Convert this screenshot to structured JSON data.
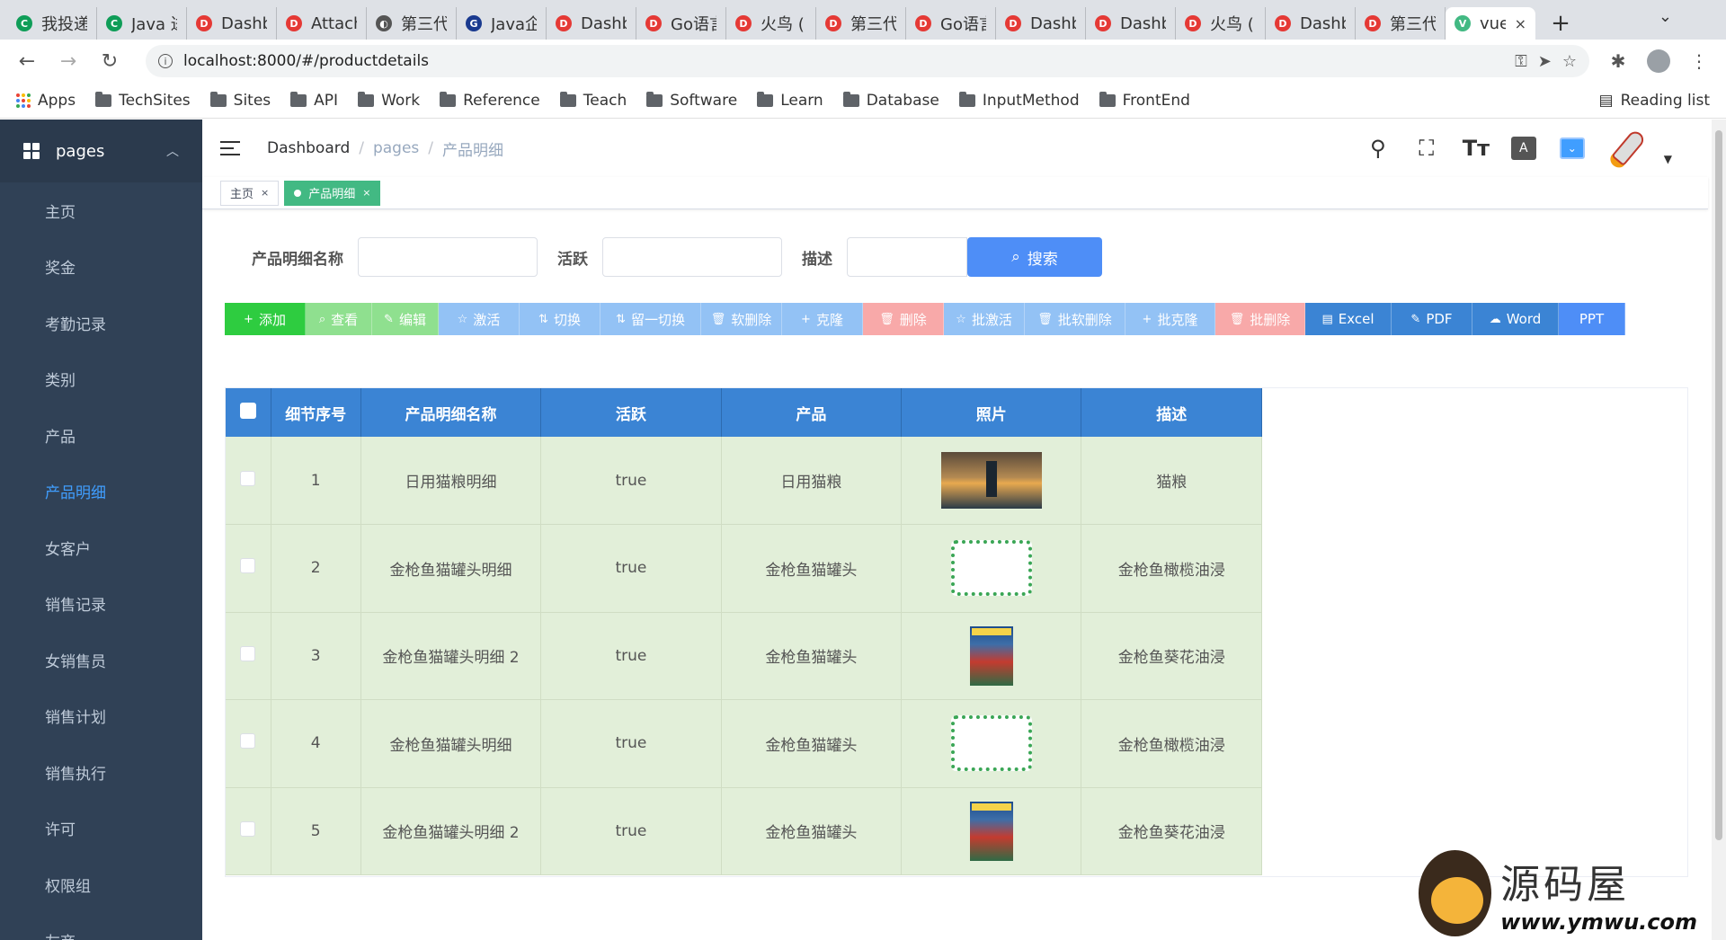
{
  "browser": {
    "tabs": [
      {
        "title": "我投递",
        "color": "#0f9d58",
        "glyph": "C"
      },
      {
        "title": "Java 进",
        "color": "#0f9d58",
        "glyph": "C"
      },
      {
        "title": "Dashb",
        "color": "#e53935",
        "glyph": "D"
      },
      {
        "title": "Attach",
        "color": "#e53935",
        "glyph": "D"
      },
      {
        "title": "第三代",
        "color": "#555555",
        "glyph": "◐"
      },
      {
        "title": "Java企",
        "color": "#1a3a8f",
        "glyph": "G"
      },
      {
        "title": "Dashb",
        "color": "#e53935",
        "glyph": "D"
      },
      {
        "title": "Go语言",
        "color": "#e53935",
        "glyph": "D"
      },
      {
        "title": "火鸟 (",
        "color": "#e53935",
        "glyph": "D"
      },
      {
        "title": "第三代",
        "color": "#e53935",
        "glyph": "D"
      },
      {
        "title": "Go语言",
        "color": "#e53935",
        "glyph": "D"
      },
      {
        "title": "Dashb",
        "color": "#e53935",
        "glyph": "D"
      },
      {
        "title": "Dashb",
        "color": "#e53935",
        "glyph": "D"
      },
      {
        "title": "火鸟 (",
        "color": "#e53935",
        "glyph": "D"
      },
      {
        "title": "Dashb",
        "color": "#e53935",
        "glyph": "D"
      },
      {
        "title": "第三代",
        "color": "#e53935",
        "glyph": "D"
      }
    ],
    "active_tab": {
      "title": "vue",
      "color": "#42b983",
      "glyph": "V",
      "close": "×"
    },
    "new_tab": "+",
    "tab_menu": "⌄",
    "url": "localhost:8000/#/productdetails",
    "bookmarks": [
      "Apps",
      "TechSites",
      "Sites",
      "API",
      "Work",
      "Reference",
      "Teach",
      "Software",
      "Learn",
      "Database",
      "InputMethod",
      "FrontEnd"
    ],
    "reading_list": "Reading list"
  },
  "sidebar": {
    "header": "pages",
    "items": [
      "主页",
      "奖金",
      "考勤记录",
      "类别",
      "产品",
      "产品明细",
      "女客户",
      "销售记录",
      "女销售员",
      "销售计划",
      "销售执行",
      "许可",
      "权限组",
      "友商"
    ],
    "active_index": 5
  },
  "navbar": {
    "breadcrumb": [
      "Dashboard",
      "pages",
      "产品明细"
    ]
  },
  "tags": {
    "items": [
      {
        "label": "主页",
        "close": "×"
      },
      {
        "label": "产品明细",
        "close": "×"
      }
    ]
  },
  "filters": {
    "name_label": "产品明细名称",
    "active_label": "活跃",
    "desc_label": "描述",
    "search_label": "搜索",
    "search_icon": "⌕"
  },
  "actions": [
    {
      "label": "添加",
      "icon": "+",
      "color": "#2ecc40",
      "width": 90
    },
    {
      "label": "查看",
      "icon": "⌕",
      "color": "#8fe08f",
      "width": 74
    },
    {
      "label": "编辑",
      "icon": "✎",
      "color": "#8fe08f",
      "width": 74
    },
    {
      "label": "激活",
      "icon": "☆",
      "color": "#93c2f5",
      "width": 90
    },
    {
      "label": "切换",
      "icon": "⇅",
      "color": "#93c2f5",
      "width": 90
    },
    {
      "label": "留一切换",
      "icon": "⇅",
      "color": "#93c2f5",
      "width": 112
    },
    {
      "label": "软删除",
      "icon": "🗑",
      "color": "#93c2f5",
      "width": 90
    },
    {
      "label": "克隆",
      "icon": "+",
      "color": "#93c2f5",
      "width": 90
    },
    {
      "label": "删除",
      "icon": "🗑",
      "color": "#f8a9a9",
      "width": 90
    },
    {
      "label": "批激活",
      "icon": "☆",
      "color": "#93c2f5",
      "width": 90
    },
    {
      "label": "批软删除",
      "icon": "🗑",
      "color": "#93c2f5",
      "width": 112
    },
    {
      "label": "批克隆",
      "icon": "+",
      "color": "#93c2f5",
      "width": 100
    },
    {
      "label": "批删除",
      "icon": "🗑",
      "color": "#f8a9a9",
      "width": 100
    },
    {
      "label": "Excel",
      "icon": "▤",
      "color": "#3b84d4",
      "width": 96
    },
    {
      "label": "PDF",
      "icon": "✎",
      "color": "#3b84d4",
      "width": 90
    },
    {
      "label": "Word",
      "icon": "☁",
      "color": "#3b84d4",
      "width": 96
    },
    {
      "label": "PPT",
      "icon": "",
      "color": "#4e8ef7",
      "width": 74
    }
  ],
  "table": {
    "headers": [
      "细节序号",
      "产品明细名称",
      "活跃",
      "产品",
      "照片",
      "描述"
    ],
    "rows": [
      {
        "id": "1",
        "name": "日用猫粮明细",
        "active": "true",
        "product": "日用猫粮",
        "photo": "bridge",
        "desc": "猫粮"
      },
      {
        "id": "2",
        "name": "金枪鱼猫罐头明细",
        "active": "true",
        "product": "金枪鱼猫罐头",
        "photo": "frame",
        "desc": "金枪鱼橄榄油浸"
      },
      {
        "id": "3",
        "name": "金枪鱼猫罐头明细 2",
        "active": "true",
        "product": "金枪鱼猫罐头",
        "photo": "magazine",
        "desc": "金枪鱼葵花油浸"
      },
      {
        "id": "4",
        "name": "金枪鱼猫罐头明细",
        "active": "true",
        "product": "金枪鱼猫罐头",
        "photo": "frame",
        "desc": "金枪鱼橄榄油浸"
      },
      {
        "id": "5",
        "name": "金枪鱼猫罐头明细 2",
        "active": "true",
        "product": "金枪鱼猫罐头",
        "photo": "magazine",
        "desc": "金枪鱼葵花油浸"
      }
    ]
  },
  "watermark": {
    "text": "源码屋",
    "url": "www.ymwu.com"
  }
}
